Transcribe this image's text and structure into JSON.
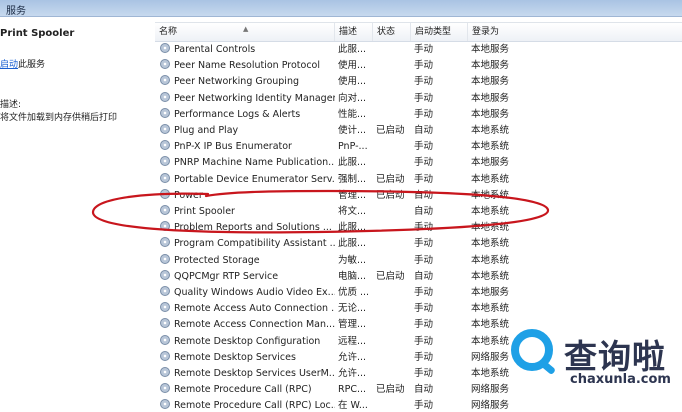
{
  "window": {
    "title": "服务"
  },
  "left_pane": {
    "service_name": "Print Spooler",
    "start_link": "启动",
    "start_suffix": "此服务",
    "description_label": "描述:",
    "description_text": "将文件加载到内存供稍后打印"
  },
  "columns": {
    "name": "名称",
    "desc": "描述",
    "status": "状态",
    "startup": "启动类型",
    "logon": "登录为"
  },
  "services": [
    {
      "name": "Parental Controls",
      "desc": "此服...",
      "status": "",
      "startup": "手动",
      "logon": "本地服务"
    },
    {
      "name": "Peer Name Resolution Protocol",
      "desc": "使用...",
      "status": "",
      "startup": "手动",
      "logon": "本地服务"
    },
    {
      "name": "Peer Networking Grouping",
      "desc": "使用...",
      "status": "",
      "startup": "手动",
      "logon": "本地服务"
    },
    {
      "name": "Peer Networking Identity Manager",
      "desc": "向对...",
      "status": "",
      "startup": "手动",
      "logon": "本地服务"
    },
    {
      "name": "Performance Logs & Alerts",
      "desc": "性能...",
      "status": "",
      "startup": "手动",
      "logon": "本地服务"
    },
    {
      "name": "Plug and Play",
      "desc": "使计...",
      "status": "已启动",
      "startup": "自动",
      "logon": "本地系统"
    },
    {
      "name": "PnP-X IP Bus Enumerator",
      "desc": "PnP-...",
      "status": "",
      "startup": "手动",
      "logon": "本地系统"
    },
    {
      "name": "PNRP Machine Name Publication...",
      "desc": "此服...",
      "status": "",
      "startup": "手动",
      "logon": "本地服务"
    },
    {
      "name": "Portable Device Enumerator Serv...",
      "desc": "强制...",
      "status": "已启动",
      "startup": "手动",
      "logon": "本地系统"
    },
    {
      "name": "Power",
      "desc": "管理...",
      "status": "已启动",
      "startup": "自动",
      "logon": "本地系统"
    },
    {
      "name": "Print Spooler",
      "desc": "将文...",
      "status": "",
      "startup": "自动",
      "logon": "本地系统"
    },
    {
      "name": "Problem Reports and Solutions ...",
      "desc": "此服...",
      "status": "",
      "startup": "手动",
      "logon": "本地系统"
    },
    {
      "name": "Program Compatibility Assistant ...",
      "desc": "此服...",
      "status": "",
      "startup": "手动",
      "logon": "本地系统"
    },
    {
      "name": "Protected Storage",
      "desc": "为敏...",
      "status": "",
      "startup": "手动",
      "logon": "本地系统"
    },
    {
      "name": "QQPCMgr RTP Service",
      "desc": "电脑...",
      "status": "已启动",
      "startup": "自动",
      "logon": "本地系统"
    },
    {
      "name": "Quality Windows Audio Video Ex...",
      "desc": "优质 ...",
      "status": "",
      "startup": "手动",
      "logon": "本地服务"
    },
    {
      "name": "Remote Access Auto Connection ...",
      "desc": "无论...",
      "status": "",
      "startup": "手动",
      "logon": "本地系统"
    },
    {
      "name": "Remote Access Connection Man...",
      "desc": "管理...",
      "status": "",
      "startup": "手动",
      "logon": "本地系统"
    },
    {
      "name": "Remote Desktop Configuration",
      "desc": "远程...",
      "status": "",
      "startup": "手动",
      "logon": "本地系统"
    },
    {
      "name": "Remote Desktop Services",
      "desc": "允许...",
      "status": "",
      "startup": "手动",
      "logon": "网络服务"
    },
    {
      "name": "Remote Desktop Services UserM...",
      "desc": "允许...",
      "status": "",
      "startup": "手动",
      "logon": "本地系统"
    },
    {
      "name": "Remote Procedure Call (RPC)",
      "desc": "RPC...",
      "status": "已启动",
      "startup": "自动",
      "logon": "网络服务"
    },
    {
      "name": "Remote Procedure Call (RPC) Loc...",
      "desc": "在 W...",
      "status": "",
      "startup": "手动",
      "logon": "网络服务"
    }
  ],
  "annotation_color": "#c8161d",
  "watermark": {
    "brand_cn": "查询啦",
    "url": "chaxunla.com",
    "logo_color": "#1ea0e6"
  }
}
